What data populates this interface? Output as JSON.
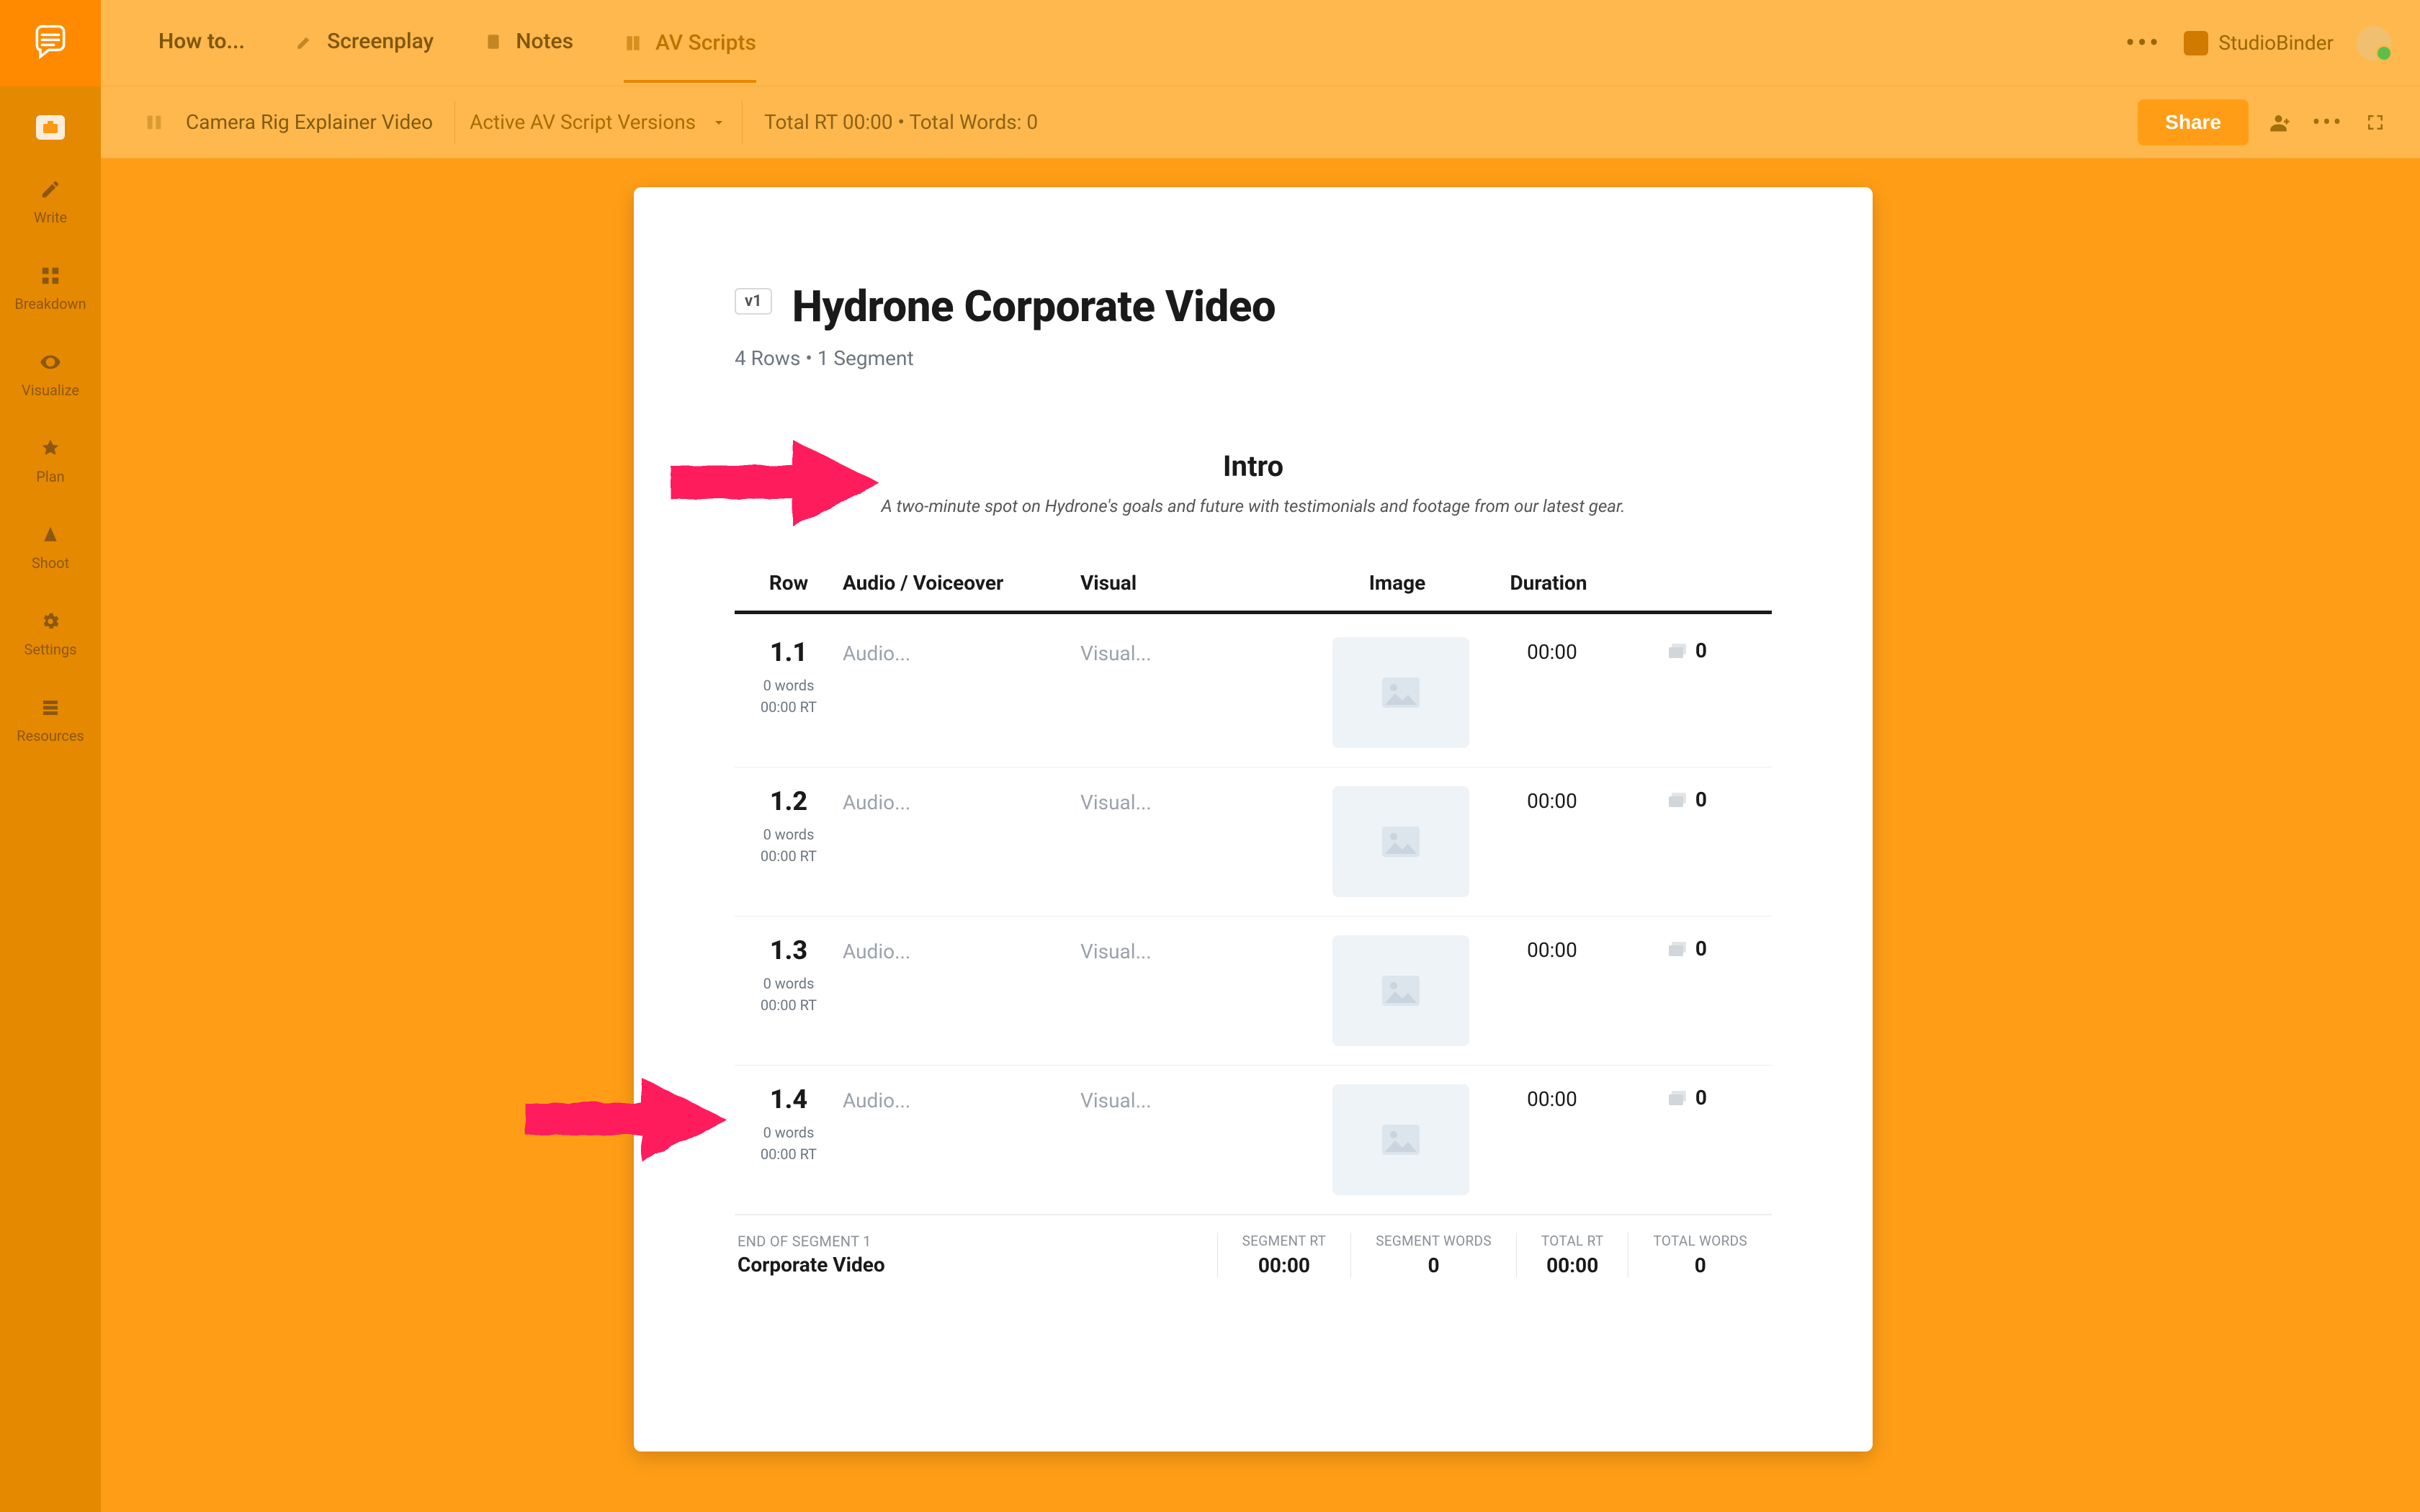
{
  "top_tabs": {
    "howto": "How to...",
    "screenplay": "Screenplay",
    "notes": "Notes",
    "avscripts": "AV Scripts"
  },
  "user": {
    "name": "StudioBinder"
  },
  "subbar": {
    "breadcrumb": "Camera Rig Explainer Video",
    "version_label": "Active AV Script Versions",
    "stats": "Total RT 00:00 • Total Words: 0",
    "share": "Share"
  },
  "sidebar": {
    "items": [
      {
        "label": ""
      },
      {
        "label": "Write"
      },
      {
        "label": "Breakdown"
      },
      {
        "label": "Visualize"
      },
      {
        "label": "Plan"
      },
      {
        "label": "Shoot"
      },
      {
        "label": "Settings"
      },
      {
        "label": "Resources"
      }
    ]
  },
  "doc": {
    "version_badge": "v1",
    "title": "Hydrone Corporate Video",
    "subtitle": "4 Rows • 1 Segment",
    "segment_title": "Intro",
    "segment_desc": "A two-minute spot on Hydrone's goals and future with testimonials and footage from our latest gear.",
    "headers": {
      "row": "Row",
      "audio": "Audio / Voiceover",
      "visual": "Visual",
      "image": "Image",
      "duration": "Duration"
    },
    "rows": [
      {
        "num": "1.1",
        "words": "0 words",
        "rt": "00:00 RT",
        "audio": "Audio...",
        "visual": "Visual...",
        "duration": "00:00",
        "count": "0"
      },
      {
        "num": "1.2",
        "words": "0 words",
        "rt": "00:00 RT",
        "audio": "Audio...",
        "visual": "Visual...",
        "duration": "00:00",
        "count": "0"
      },
      {
        "num": "1.3",
        "words": "0 words",
        "rt": "00:00 RT",
        "audio": "Audio...",
        "visual": "Visual...",
        "duration": "00:00",
        "count": "0"
      },
      {
        "num": "1.4",
        "words": "0 words",
        "rt": "00:00 RT",
        "audio": "Audio...",
        "visual": "Visual...",
        "duration": "00:00",
        "count": "0"
      }
    ],
    "footer": {
      "end_label": "END OF SEGMENT 1",
      "seg_name": "Corporate Video",
      "seg_rt_label": "SEGMENT RT",
      "seg_rt": "00:00",
      "seg_words_label": "SEGMENT WORDS",
      "seg_words": "0",
      "total_rt_label": "TOTAL RT",
      "total_rt": "00:00",
      "total_words_label": "TOTAL WORDS",
      "total_words": "0"
    }
  }
}
